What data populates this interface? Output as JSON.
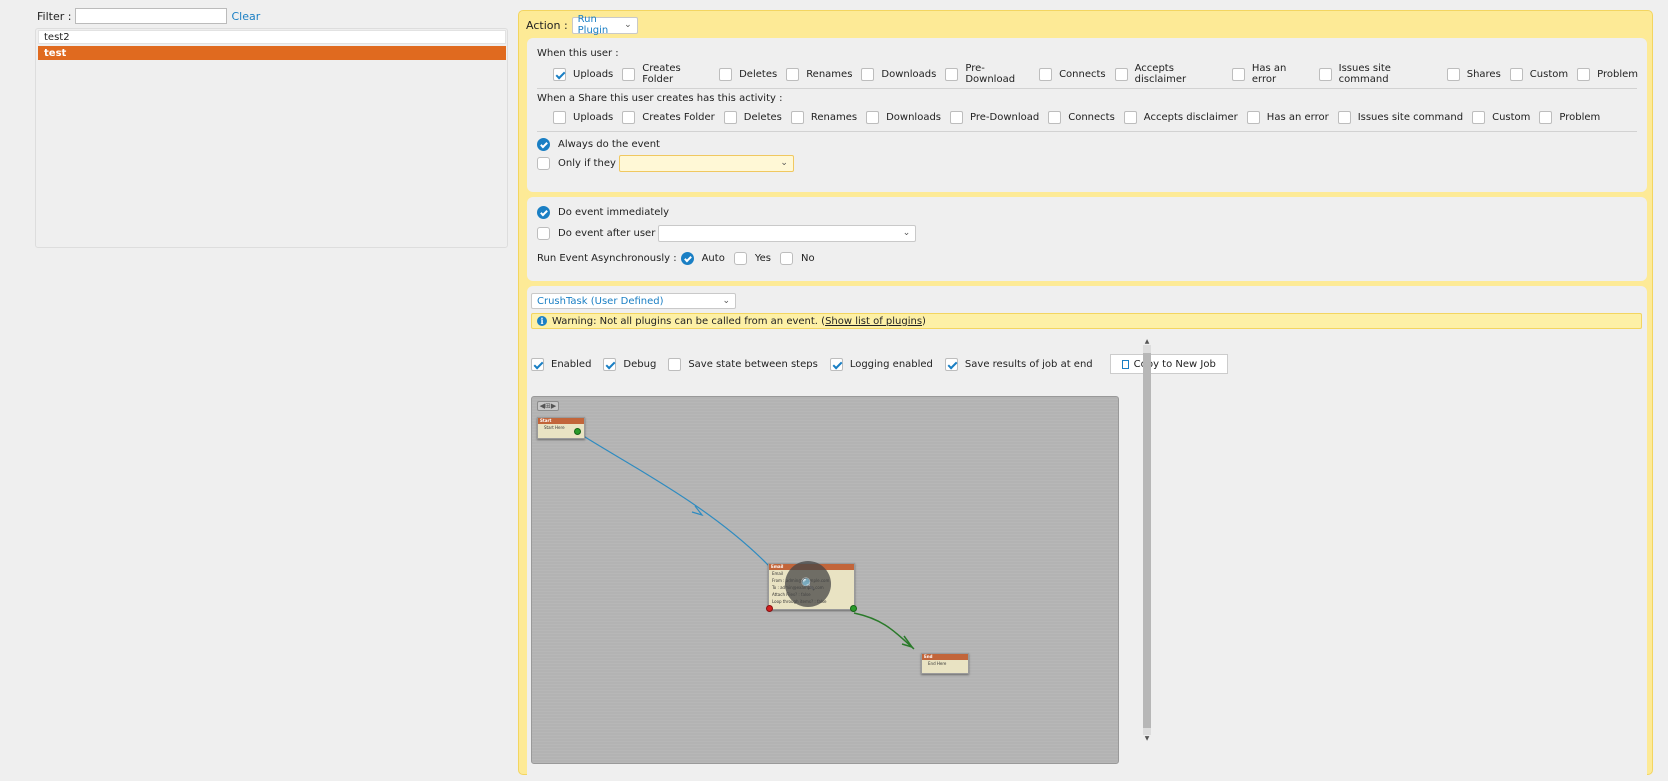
{
  "left": {
    "filter_label": "Filter :",
    "filter_value": "",
    "clear_label": "Clear",
    "users": [
      {
        "name": "test2",
        "selected": false
      },
      {
        "name": "test",
        "selected": true
      }
    ]
  },
  "action": {
    "label": "Action :",
    "selected": "Run Plugin"
  },
  "when_user": {
    "title": "When this user :",
    "events": [
      {
        "label": "Uploads",
        "checked": true
      },
      {
        "label": "Creates Folder",
        "checked": false
      },
      {
        "label": "Deletes",
        "checked": false
      },
      {
        "label": "Renames",
        "checked": false
      },
      {
        "label": "Downloads",
        "checked": false
      },
      {
        "label": "Pre-Download",
        "checked": false
      },
      {
        "label": "Connects",
        "checked": false
      },
      {
        "label": "Accepts disclaimer",
        "checked": false
      },
      {
        "label": "Has an error",
        "checked": false
      },
      {
        "label": "Issues site command",
        "checked": false
      },
      {
        "label": "Shares",
        "checked": false
      },
      {
        "label": "Custom",
        "checked": false
      },
      {
        "label": "Problem",
        "checked": false
      }
    ]
  },
  "when_share": {
    "title": "When a Share this user creates has this activity :",
    "events": [
      {
        "label": "Uploads",
        "checked": false
      },
      {
        "label": "Creates Folder",
        "checked": false
      },
      {
        "label": "Deletes",
        "checked": false
      },
      {
        "label": "Renames",
        "checked": false
      },
      {
        "label": "Downloads",
        "checked": false
      },
      {
        "label": "Pre-Download",
        "checked": false
      },
      {
        "label": "Connects",
        "checked": false
      },
      {
        "label": "Accepts disclaimer",
        "checked": false
      },
      {
        "label": "Has an error",
        "checked": false
      },
      {
        "label": "Issues site command",
        "checked": false
      },
      {
        "label": "Custom",
        "checked": false
      },
      {
        "label": "Problem",
        "checked": false
      }
    ]
  },
  "condition": {
    "always_label": "Always do the event",
    "always_checked": true,
    "only_if_label": "Only if they",
    "only_if_value": ""
  },
  "timing": {
    "immediate_label": "Do event immediately",
    "immediate_checked": true,
    "after_user_label": "Do event after user",
    "after_user_value": "",
    "async_label": "Run Event Asynchronously :",
    "async_options": [
      {
        "label": "Auto",
        "checked": true
      },
      {
        "label": "Yes",
        "checked": false
      },
      {
        "label": "No",
        "checked": false
      }
    ]
  },
  "plugin": {
    "selected": "CrushTask (User Defined)",
    "warning_text": "Warning: Not all plugins can be called from an event. (",
    "warning_link": "Show list of plugins",
    "warning_end": ")",
    "options": [
      {
        "label": "Enabled",
        "checked": true
      },
      {
        "label": "Debug",
        "checked": true
      },
      {
        "label": "Save state between steps",
        "checked": false
      },
      {
        "label": "Logging enabled",
        "checked": true
      },
      {
        "label": "Save results of job at end",
        "checked": true
      }
    ],
    "copy_button": "Copy to New Job"
  },
  "flow": {
    "link_color": "#2e8bc0",
    "link2_color": "#2a7a2a",
    "start": {
      "title": "Start",
      "row": "Start Here"
    },
    "email": {
      "title": "Email",
      "badge": "Email",
      "rows": [
        "From : admin@example.com",
        "To : admin@example.com",
        "Attach Files? : false",
        "Loop through items? : false"
      ]
    },
    "end": {
      "title": "End",
      "row": "End Here"
    }
  }
}
